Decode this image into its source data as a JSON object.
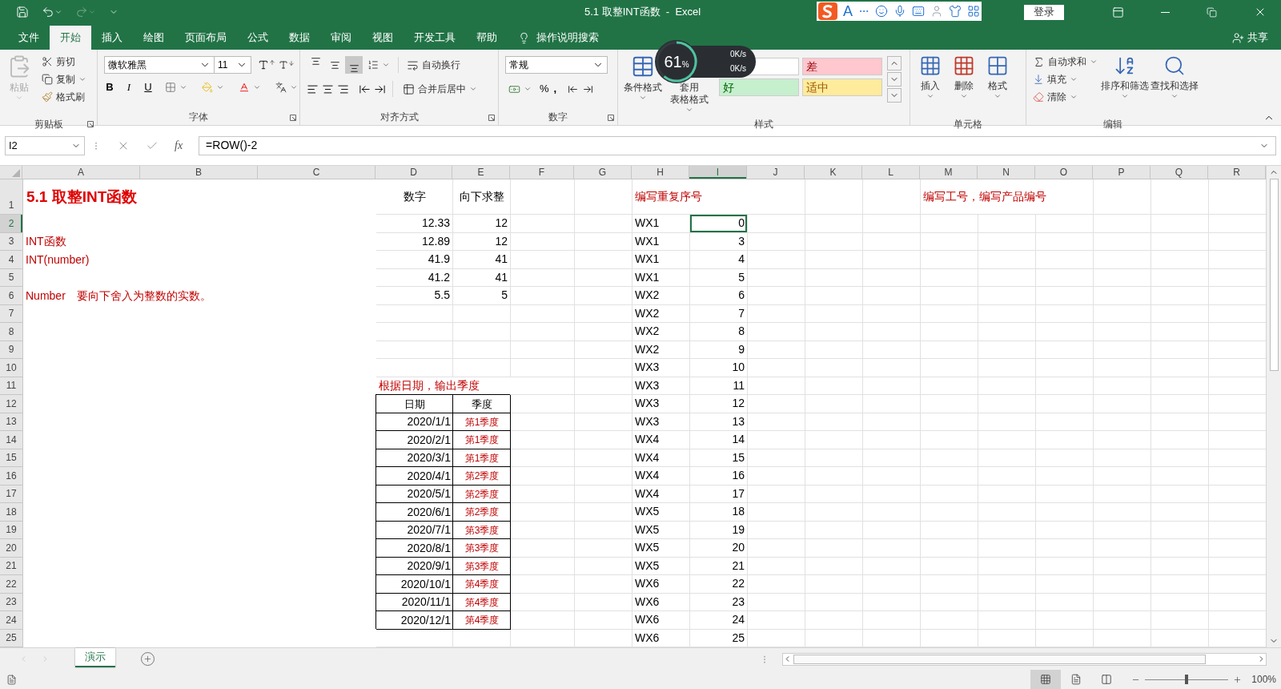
{
  "title_bar": {
    "title": "5.1 取整INT函数  -  Excel",
    "login": "登录",
    "ime_label": "A"
  },
  "menu_tabs": [
    {
      "label": "文件",
      "selected": false
    },
    {
      "label": "开始",
      "selected": true
    },
    {
      "label": "插入",
      "selected": false
    },
    {
      "label": "绘图",
      "selected": false
    },
    {
      "label": "页面布局",
      "selected": false
    },
    {
      "label": "公式",
      "selected": false
    },
    {
      "label": "数据",
      "selected": false
    },
    {
      "label": "审阅",
      "selected": false
    },
    {
      "label": "视图",
      "selected": false
    },
    {
      "label": "开发工具",
      "selected": false
    },
    {
      "label": "帮助",
      "selected": false
    }
  ],
  "tell_me": "操作说明搜索",
  "share": "共享",
  "ribbon": {
    "groups": [
      {
        "kind": "clipboard",
        "label": "剪贴板",
        "paste": {
          "label": "粘贴",
          "disabled": true
        },
        "buttons": [
          "剪切",
          "复制",
          "格式刷"
        ]
      },
      {
        "kind": "font",
        "label": "字体",
        "font_name": "微软雅黑",
        "font_size": "11",
        "styles": [
          {
            "label": "B",
            "kind": "bold"
          },
          {
            "label": "I",
            "kind": "italic"
          },
          {
            "label": "U",
            "kind": "underline"
          }
        ]
      },
      {
        "kind": "alignment",
        "label": "对齐方式",
        "vertical": [
          {
            "kind": "top",
            "selected": false
          },
          {
            "kind": "middle",
            "selected": false
          },
          {
            "kind": "bottom",
            "selected": true
          }
        ],
        "buttons": [
          "自动换行",
          "合并后居中"
        ]
      },
      {
        "kind": "number",
        "label": "数字",
        "format": "常规",
        "marks": [
          "%",
          ","
        ]
      },
      {
        "kind": "styles",
        "label": "样式",
        "buttons": [
          "条件格式",
          "套用",
          "表格格式"
        ],
        "cell_styles": [
          {
            "color": "#ffffff"
          },
          {
            "text": "差",
            "color": "#ffc7ce"
          },
          {
            "text": "好",
            "color": "#c6efce"
          },
          {
            "text": "适中",
            "color": "#ffeb9c"
          }
        ]
      },
      {
        "kind": "cells",
        "label": "单元格",
        "buttons": [
          "插入",
          "删除",
          "格式"
        ]
      },
      {
        "kind": "editing",
        "label": "编辑",
        "small": [
          "自动求和",
          "填充",
          "清除"
        ],
        "large": [
          "排序和筛选",
          "查找和选择"
        ]
      }
    ]
  },
  "meter": {
    "percent": "61",
    "unit": "%",
    "up": "0K/s",
    "down": "0K/s"
  },
  "formula_bar": {
    "name_box": "I2",
    "fx_label": "fx",
    "formula": "=ROW()-2"
  },
  "sheet": {
    "columns": [
      "A",
      "B",
      "C",
      "D",
      "E",
      "F",
      "G",
      "H",
      "I",
      "J",
      "K",
      "L",
      "M",
      "N",
      "O",
      "P",
      "Q",
      "R"
    ],
    "rows": [
      {
        "label": "1",
        "cells": [
          {
            "text": "5.1 取整INT函数",
            "kind": "title",
            "selected": false
          },
          {
            "selected": false
          },
          {
            "selected": false
          },
          {
            "text": "数字",
            "kind": "heading",
            "selected": false
          },
          {
            "text": "向下求整",
            "kind": "heading",
            "selected": false
          },
          {
            "selected": false
          },
          {
            "selected": false
          },
          {
            "text": "编写重复序号",
            "kind": "note",
            "selected": false
          },
          {
            "selected": false
          },
          {
            "selected": false
          },
          {
            "selected": false
          },
          {
            "selected": false
          },
          {
            "text": "编写工号，编写产品编号",
            "kind": "note",
            "selected": false
          },
          {
            "selected": false
          },
          {
            "selected": false
          },
          {
            "selected": false
          },
          {
            "selected": false
          },
          {
            "selected": false
          }
        ]
      },
      {
        "label": "2",
        "cells": [
          {
            "selected": false
          },
          {
            "selected": false
          },
          {
            "selected": false
          },
          {
            "text": "12.33",
            "kind": "number",
            "selected": false
          },
          {
            "text": "12",
            "kind": "number",
            "selected": false
          },
          {
            "selected": false
          },
          {
            "selected": false
          },
          {
            "text": "WX1",
            "kind": "text",
            "selected": false
          },
          {
            "text": "0",
            "kind": "number",
            "selected": true
          },
          {
            "selected": false
          },
          {
            "selected": false
          },
          {
            "selected": false
          },
          {
            "selected": false
          },
          {
            "selected": false
          },
          {
            "selected": false
          },
          {
            "selected": false
          },
          {
            "selected": false
          },
          {
            "selected": false
          }
        ]
      },
      {
        "label": "3",
        "cells": [
          {
            "text": "INT函数",
            "kind": "note",
            "selected": false
          },
          {
            "selected": false
          },
          {
            "selected": false
          },
          {
            "text": "12.89",
            "kind": "number",
            "selected": false
          },
          {
            "text": "12",
            "kind": "number",
            "selected": false
          },
          {
            "selected": false
          },
          {
            "selected": false
          },
          {
            "text": "WX1",
            "kind": "text",
            "selected": false
          },
          {
            "text": "3",
            "kind": "number",
            "selected": false
          },
          {
            "selected": false
          },
          {
            "selected": false
          },
          {
            "selected": false
          },
          {
            "selected": false
          },
          {
            "selected": false
          },
          {
            "selected": false
          },
          {
            "selected": false
          },
          {
            "selected": false
          },
          {
            "selected": false
          }
        ]
      },
      {
        "label": "4",
        "cells": [
          {
            "text": "INT(number)",
            "kind": "note",
            "selected": false
          },
          {
            "selected": false
          },
          {
            "selected": false
          },
          {
            "text": "41.9",
            "kind": "number",
            "selected": false
          },
          {
            "text": "41",
            "kind": "number",
            "selected": false
          },
          {
            "selected": false
          },
          {
            "selected": false
          },
          {
            "text": "WX1",
            "kind": "text",
            "selected": false
          },
          {
            "text": "4",
            "kind": "number",
            "selected": false
          },
          {
            "selected": false
          },
          {
            "selected": false
          },
          {
            "selected": false
          },
          {
            "selected": false
          },
          {
            "selected": false
          },
          {
            "selected": false
          },
          {
            "selected": false
          },
          {
            "selected": false
          },
          {
            "selected": false
          }
        ]
      },
      {
        "label": "5",
        "cells": [
          {
            "selected": false
          },
          {
            "selected": false
          },
          {
            "selected": false
          },
          {
            "text": "41.2",
            "kind": "number",
            "selected": false
          },
          {
            "text": "41",
            "kind": "number",
            "selected": false
          },
          {
            "selected": false
          },
          {
            "selected": false
          },
          {
            "text": "WX1",
            "kind": "text",
            "selected": false
          },
          {
            "text": "5",
            "kind": "number",
            "selected": false
          },
          {
            "selected": false
          },
          {
            "selected": false
          },
          {
            "selected": false
          },
          {
            "selected": false
          },
          {
            "selected": false
          },
          {
            "selected": false
          },
          {
            "selected": false
          },
          {
            "selected": false
          },
          {
            "selected": false
          }
        ]
      },
      {
        "label": "6",
        "cells": [
          {
            "text": "Number　要向下舍入为整数的实数。",
            "kind": "note",
            "selected": false
          },
          {
            "selected": false
          },
          {
            "selected": false
          },
          {
            "text": "5.5",
            "kind": "number",
            "selected": false
          },
          {
            "text": "5",
            "kind": "number",
            "selected": false
          },
          {
            "selected": false
          },
          {
            "selected": false
          },
          {
            "text": "WX2",
            "kind": "text",
            "selected": false
          },
          {
            "text": "6",
            "kind": "number",
            "selected": false
          },
          {
            "selected": false
          },
          {
            "selected": false
          },
          {
            "selected": false
          },
          {
            "selected": false
          },
          {
            "selected": false
          },
          {
            "selected": false
          },
          {
            "selected": false
          },
          {
            "selected": false
          },
          {
            "selected": false
          }
        ]
      },
      {
        "label": "7",
        "cells": [
          {
            "selected": false
          },
          {
            "selected": false
          },
          {
            "selected": false
          },
          {
            "selected": false
          },
          {
            "selected": false
          },
          {
            "selected": false
          },
          {
            "selected": false
          },
          {
            "text": "WX2",
            "kind": "text",
            "selected": false
          },
          {
            "text": "7",
            "kind": "number",
            "selected": false
          },
          {
            "selected": false
          },
          {
            "selected": false
          },
          {
            "selected": false
          },
          {
            "selected": false
          },
          {
            "selected": false
          },
          {
            "selected": false
          },
          {
            "selected": false
          },
          {
            "selected": false
          },
          {
            "selected": false
          }
        ]
      },
      {
        "label": "8",
        "cells": [
          {
            "selected": false
          },
          {
            "selected": false
          },
          {
            "selected": false
          },
          {
            "selected": false
          },
          {
            "selected": false
          },
          {
            "selected": false
          },
          {
            "selected": false
          },
          {
            "text": "WX2",
            "kind": "text",
            "selected": false
          },
          {
            "text": "8",
            "kind": "number",
            "selected": false
          },
          {
            "selected": false
          },
          {
            "selected": false
          },
          {
            "selected": false
          },
          {
            "selected": false
          },
          {
            "selected": false
          },
          {
            "selected": false
          },
          {
            "selected": false
          },
          {
            "selected": false
          },
          {
            "selected": false
          }
        ]
      },
      {
        "label": "9",
        "cells": [
          {
            "selected": false
          },
          {
            "selected": false
          },
          {
            "selected": false
          },
          {
            "selected": false
          },
          {
            "selected": false
          },
          {
            "selected": false
          },
          {
            "selected": false
          },
          {
            "text": "WX2",
            "kind": "text",
            "selected": false
          },
          {
            "text": "9",
            "kind": "number",
            "selected": false
          },
          {
            "selected": false
          },
          {
            "selected": false
          },
          {
            "selected": false
          },
          {
            "selected": false
          },
          {
            "selected": false
          },
          {
            "selected": false
          },
          {
            "selected": false
          },
          {
            "selected": false
          },
          {
            "selected": false
          }
        ]
      },
      {
        "label": "10",
        "cells": [
          {
            "selected": false
          },
          {
            "selected": false
          },
          {
            "selected": false
          },
          {
            "selected": false
          },
          {
            "selected": false
          },
          {
            "selected": false
          },
          {
            "selected": false
          },
          {
            "text": "WX3",
            "kind": "text",
            "selected": false
          },
          {
            "text": "10",
            "kind": "number",
            "selected": false
          },
          {
            "selected": false
          },
          {
            "selected": false
          },
          {
            "selected": false
          },
          {
            "selected": false
          },
          {
            "selected": false
          },
          {
            "selected": false
          },
          {
            "selected": false
          },
          {
            "selected": false
          },
          {
            "selected": false
          }
        ]
      },
      {
        "label": "11",
        "cells": [
          {
            "selected": false
          },
          {
            "selected": false
          },
          {
            "selected": false
          },
          {
            "text": "根据日期，输出季度",
            "kind": "note",
            "selected": false
          },
          {
            "selected": false
          },
          {
            "selected": false
          },
          {
            "selected": false
          },
          {
            "text": "WX3",
            "kind": "text",
            "selected": false
          },
          {
            "text": "11",
            "kind": "number",
            "selected": false
          },
          {
            "selected": false
          },
          {
            "selected": false
          },
          {
            "selected": false
          },
          {
            "selected": false
          },
          {
            "selected": false
          },
          {
            "selected": false
          },
          {
            "selected": false
          },
          {
            "selected": false
          },
          {
            "selected": false
          }
        ]
      },
      {
        "label": "12",
        "cells": [
          {
            "selected": false
          },
          {
            "selected": false
          },
          {
            "selected": false
          },
          {
            "text": "日期",
            "kind": "table_head",
            "selected": false
          },
          {
            "text": "季度",
            "kind": "table_head",
            "selected": false
          },
          {
            "selected": false
          },
          {
            "selected": false
          },
          {
            "text": "WX3",
            "kind": "text",
            "selected": false
          },
          {
            "text": "12",
            "kind": "number",
            "selected": false
          },
          {
            "selected": false
          },
          {
            "selected": false
          },
          {
            "selected": false
          },
          {
            "selected": false
          },
          {
            "selected": false
          },
          {
            "selected": false
          },
          {
            "selected": false
          },
          {
            "selected": false
          },
          {
            "selected": false
          }
        ]
      },
      {
        "label": "13",
        "cells": [
          {
            "selected": false
          },
          {
            "selected": false
          },
          {
            "selected": false
          },
          {
            "text": "2020/1/1",
            "kind": "date",
            "selected": false
          },
          {
            "text": "第1季度",
            "kind": "quarter",
            "selected": false
          },
          {
            "selected": false
          },
          {
            "selected": false
          },
          {
            "text": "WX3",
            "kind": "text",
            "selected": false
          },
          {
            "text": "13",
            "kind": "number",
            "selected": false
          },
          {
            "selected": false
          },
          {
            "selected": false
          },
          {
            "selected": false
          },
          {
            "selected": false
          },
          {
            "selected": false
          },
          {
            "selected": false
          },
          {
            "selected": false
          },
          {
            "selected": false
          },
          {
            "selected": false
          }
        ]
      },
      {
        "label": "14",
        "cells": [
          {
            "selected": false
          },
          {
            "selected": false
          },
          {
            "selected": false
          },
          {
            "text": "2020/2/1",
            "kind": "date",
            "selected": false
          },
          {
            "text": "第1季度",
            "kind": "quarter",
            "selected": false
          },
          {
            "selected": false
          },
          {
            "selected": false
          },
          {
            "text": "WX4",
            "kind": "text",
            "selected": false
          },
          {
            "text": "14",
            "kind": "number",
            "selected": false
          },
          {
            "selected": false
          },
          {
            "selected": false
          },
          {
            "selected": false
          },
          {
            "selected": false
          },
          {
            "selected": false
          },
          {
            "selected": false
          },
          {
            "selected": false
          },
          {
            "selected": false
          },
          {
            "selected": false
          }
        ]
      },
      {
        "label": "15",
        "cells": [
          {
            "selected": false
          },
          {
            "selected": false
          },
          {
            "selected": false
          },
          {
            "text": "2020/3/1",
            "kind": "date",
            "selected": false
          },
          {
            "text": "第1季度",
            "kind": "quarter",
            "selected": false
          },
          {
            "selected": false
          },
          {
            "selected": false
          },
          {
            "text": "WX4",
            "kind": "text",
            "selected": false
          },
          {
            "text": "15",
            "kind": "number",
            "selected": false
          },
          {
            "selected": false
          },
          {
            "selected": false
          },
          {
            "selected": false
          },
          {
            "selected": false
          },
          {
            "selected": false
          },
          {
            "selected": false
          },
          {
            "selected": false
          },
          {
            "selected": false
          },
          {
            "selected": false
          }
        ]
      },
      {
        "label": "16",
        "cells": [
          {
            "selected": false
          },
          {
            "selected": false
          },
          {
            "selected": false
          },
          {
            "text": "2020/4/1",
            "kind": "date",
            "selected": false
          },
          {
            "text": "第2季度",
            "kind": "quarter",
            "selected": false
          },
          {
            "selected": false
          },
          {
            "selected": false
          },
          {
            "text": "WX4",
            "kind": "text",
            "selected": false
          },
          {
            "text": "16",
            "kind": "number",
            "selected": false
          },
          {
            "selected": false
          },
          {
            "selected": false
          },
          {
            "selected": false
          },
          {
            "selected": false
          },
          {
            "selected": false
          },
          {
            "selected": false
          },
          {
            "selected": false
          },
          {
            "selected": false
          },
          {
            "selected": false
          }
        ]
      },
      {
        "label": "17",
        "cells": [
          {
            "selected": false
          },
          {
            "selected": false
          },
          {
            "selected": false
          },
          {
            "text": "2020/5/1",
            "kind": "date",
            "selected": false
          },
          {
            "text": "第2季度",
            "kind": "quarter",
            "selected": false
          },
          {
            "selected": false
          },
          {
            "selected": false
          },
          {
            "text": "WX4",
            "kind": "text",
            "selected": false
          },
          {
            "text": "17",
            "kind": "number",
            "selected": false
          },
          {
            "selected": false
          },
          {
            "selected": false
          },
          {
            "selected": false
          },
          {
            "selected": false
          },
          {
            "selected": false
          },
          {
            "selected": false
          },
          {
            "selected": false
          },
          {
            "selected": false
          },
          {
            "selected": false
          }
        ]
      },
      {
        "label": "18",
        "cells": [
          {
            "selected": false
          },
          {
            "selected": false
          },
          {
            "selected": false
          },
          {
            "text": "2020/6/1",
            "kind": "date",
            "selected": false
          },
          {
            "text": "第2季度",
            "kind": "quarter",
            "selected": false
          },
          {
            "selected": false
          },
          {
            "selected": false
          },
          {
            "text": "WX5",
            "kind": "text",
            "selected": false
          },
          {
            "text": "18",
            "kind": "number",
            "selected": false
          },
          {
            "selected": false
          },
          {
            "selected": false
          },
          {
            "selected": false
          },
          {
            "selected": false
          },
          {
            "selected": false
          },
          {
            "selected": false
          },
          {
            "selected": false
          },
          {
            "selected": false
          },
          {
            "selected": false
          }
        ]
      },
      {
        "label": "19",
        "cells": [
          {
            "selected": false
          },
          {
            "selected": false
          },
          {
            "selected": false
          },
          {
            "text": "2020/7/1",
            "kind": "date",
            "selected": false
          },
          {
            "text": "第3季度",
            "kind": "quarter",
            "selected": false
          },
          {
            "selected": false
          },
          {
            "selected": false
          },
          {
            "text": "WX5",
            "kind": "text",
            "selected": false
          },
          {
            "text": "19",
            "kind": "number",
            "selected": false
          },
          {
            "selected": false
          },
          {
            "selected": false
          },
          {
            "selected": false
          },
          {
            "selected": false
          },
          {
            "selected": false
          },
          {
            "selected": false
          },
          {
            "selected": false
          },
          {
            "selected": false
          },
          {
            "selected": false
          }
        ]
      },
      {
        "label": "20",
        "cells": [
          {
            "selected": false
          },
          {
            "selected": false
          },
          {
            "selected": false
          },
          {
            "text": "2020/8/1",
            "kind": "date",
            "selected": false
          },
          {
            "text": "第3季度",
            "kind": "quarter",
            "selected": false
          },
          {
            "selected": false
          },
          {
            "selected": false
          },
          {
            "text": "WX5",
            "kind": "text",
            "selected": false
          },
          {
            "text": "20",
            "kind": "number",
            "selected": false
          },
          {
            "selected": false
          },
          {
            "selected": false
          },
          {
            "selected": false
          },
          {
            "selected": false
          },
          {
            "selected": false
          },
          {
            "selected": false
          },
          {
            "selected": false
          },
          {
            "selected": false
          },
          {
            "selected": false
          }
        ]
      },
      {
        "label": "21",
        "cells": [
          {
            "selected": false
          },
          {
            "selected": false
          },
          {
            "selected": false
          },
          {
            "text": "2020/9/1",
            "kind": "date",
            "selected": false
          },
          {
            "text": "第3季度",
            "kind": "quarter",
            "selected": false
          },
          {
            "selected": false
          },
          {
            "selected": false
          },
          {
            "text": "WX5",
            "kind": "text",
            "selected": false
          },
          {
            "text": "21",
            "kind": "number",
            "selected": false
          },
          {
            "selected": false
          },
          {
            "selected": false
          },
          {
            "selected": false
          },
          {
            "selected": false
          },
          {
            "selected": false
          },
          {
            "selected": false
          },
          {
            "selected": false
          },
          {
            "selected": false
          },
          {
            "selected": false
          }
        ]
      },
      {
        "label": "22",
        "cells": [
          {
            "selected": false
          },
          {
            "selected": false
          },
          {
            "selected": false
          },
          {
            "text": "2020/10/1",
            "kind": "date",
            "selected": false
          },
          {
            "text": "第4季度",
            "kind": "quarter",
            "selected": false
          },
          {
            "selected": false
          },
          {
            "selected": false
          },
          {
            "text": "WX6",
            "kind": "text",
            "selected": false
          },
          {
            "text": "22",
            "kind": "number",
            "selected": false
          },
          {
            "selected": false
          },
          {
            "selected": false
          },
          {
            "selected": false
          },
          {
            "selected": false
          },
          {
            "selected": false
          },
          {
            "selected": false
          },
          {
            "selected": false
          },
          {
            "selected": false
          },
          {
            "selected": false
          }
        ]
      },
      {
        "label": "23",
        "cells": [
          {
            "selected": false
          },
          {
            "selected": false
          },
          {
            "selected": false
          },
          {
            "text": "2020/11/1",
            "kind": "date",
            "selected": false
          },
          {
            "text": "第4季度",
            "kind": "quarter",
            "selected": false
          },
          {
            "selected": false
          },
          {
            "selected": false
          },
          {
            "text": "WX6",
            "kind": "text",
            "selected": false
          },
          {
            "text": "23",
            "kind": "number",
            "selected": false
          },
          {
            "selected": false
          },
          {
            "selected": false
          },
          {
            "selected": false
          },
          {
            "selected": false
          },
          {
            "selected": false
          },
          {
            "selected": false
          },
          {
            "selected": false
          },
          {
            "selected": false
          },
          {
            "selected": false
          }
        ]
      },
      {
        "label": "24",
        "cells": [
          {
            "selected": false
          },
          {
            "selected": false
          },
          {
            "selected": false
          },
          {
            "text": "2020/12/1",
            "kind": "date",
            "selected": false
          },
          {
            "text": "第4季度",
            "kind": "quarter",
            "selected": false
          },
          {
            "selected": false
          },
          {
            "selected": false
          },
          {
            "text": "WX6",
            "kind": "text",
            "selected": false
          },
          {
            "text": "24",
            "kind": "number",
            "selected": false
          },
          {
            "selected": false
          },
          {
            "selected": false
          },
          {
            "selected": false
          },
          {
            "selected": false
          },
          {
            "selected": false
          },
          {
            "selected": false
          },
          {
            "selected": false
          },
          {
            "selected": false
          },
          {
            "selected": false
          }
        ]
      },
      {
        "label": "25",
        "cells": [
          {
            "selected": false
          },
          {
            "selected": false
          },
          {
            "selected": false
          },
          {
            "selected": false
          },
          {
            "selected": false
          },
          {
            "selected": false
          },
          {
            "selected": false
          },
          {
            "text": "WX6",
            "kind": "text",
            "selected": false
          },
          {
            "text": "25",
            "kind": "number",
            "selected": false
          },
          {
            "selected": false
          },
          {
            "selected": false
          },
          {
            "selected": false
          },
          {
            "selected": false
          },
          {
            "selected": false
          },
          {
            "selected": false
          },
          {
            "selected": false
          },
          {
            "selected": false
          },
          {
            "selected": false
          }
        ]
      }
    ]
  },
  "sheet_tabs": [
    {
      "label": "演示",
      "selected": true
    }
  ],
  "status_bar": {
    "views": [
      {
        "kind": "normal",
        "selected": true
      },
      {
        "kind": "page_layout",
        "selected": false
      },
      {
        "kind": "page_break",
        "selected": false
      }
    ],
    "zoom": {
      "level": 0.5,
      "reading": "100%"
    }
  }
}
